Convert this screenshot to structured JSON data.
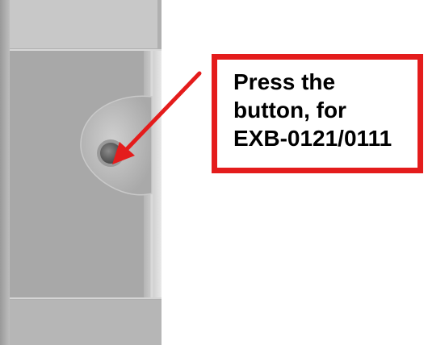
{
  "callout": {
    "line1": "Press the",
    "line2": "button, for",
    "line3": "EXB-0121/0111"
  },
  "colors": {
    "callout_border": "#e41c1c",
    "arrow": "#e41c1c",
    "device_gray": "#a6a6a6"
  },
  "icons": {
    "device": "device-panel-photo",
    "button": "round-push-button",
    "arrow": "pointer-arrow"
  }
}
